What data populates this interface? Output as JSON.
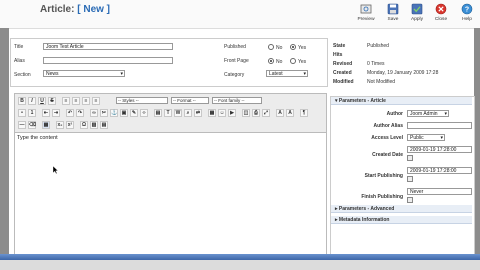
{
  "header": {
    "title": "Article:",
    "title_edit": "[ New ]",
    "toolbar": [
      {
        "label": "Preview",
        "icon": "preview-icon"
      },
      {
        "label": "Save",
        "icon": "save-icon"
      },
      {
        "label": "Apply",
        "icon": "apply-icon"
      },
      {
        "label": "Close",
        "icon": "close-icon"
      },
      {
        "label": "Help",
        "icon": "help-icon"
      }
    ]
  },
  "form": {
    "title_label": "Title",
    "title_value": "Joom Test Article",
    "alias_label": "Alias",
    "alias_value": "",
    "section_label": "Section",
    "section_value": "News",
    "published_label": "Published",
    "frontpage_label": "Front Page",
    "category_label": "Category",
    "category_value": "Latest",
    "no_label": "No",
    "yes_label": "Yes",
    "published_selected": "Yes",
    "frontpage_selected": "No"
  },
  "status": [
    {
      "key": "State",
      "value": "Published"
    },
    {
      "key": "Hits",
      "value": ""
    },
    {
      "key": "Revised",
      "value": "0 Times"
    },
    {
      "key": "Created",
      "value": "Monday, 19 January 2009 17:28"
    },
    {
      "key": "Modified",
      "value": "Not Modified"
    }
  ],
  "editor": {
    "styles_placeholder": "-- Styles --",
    "format_placeholder": "-- Format --",
    "font_placeholder": "-- Font family --",
    "content": "Type the content"
  },
  "params": {
    "article_header": "Parameters - Article",
    "advanced_header": "Parameters - Advanced",
    "metadata_header": "Metadata Information",
    "author_label": "Author",
    "author_value": "Joom Admin",
    "author_alias_label": "Author Alias",
    "author_alias_value": "",
    "access_label": "Access Level",
    "access_value": "Public",
    "created_date_label": "Created Date",
    "created_date_value": "2009-01-19 17:28:00",
    "start_label": "Start Publishing",
    "start_value": "2009-01-19 17:28:00",
    "finish_label": "Finish Publishing",
    "finish_value": "Never"
  },
  "colors": {
    "accent": "#2a6bb5",
    "bottom_bar": "#3d66a8",
    "side_gray": "#8c8c8c"
  }
}
